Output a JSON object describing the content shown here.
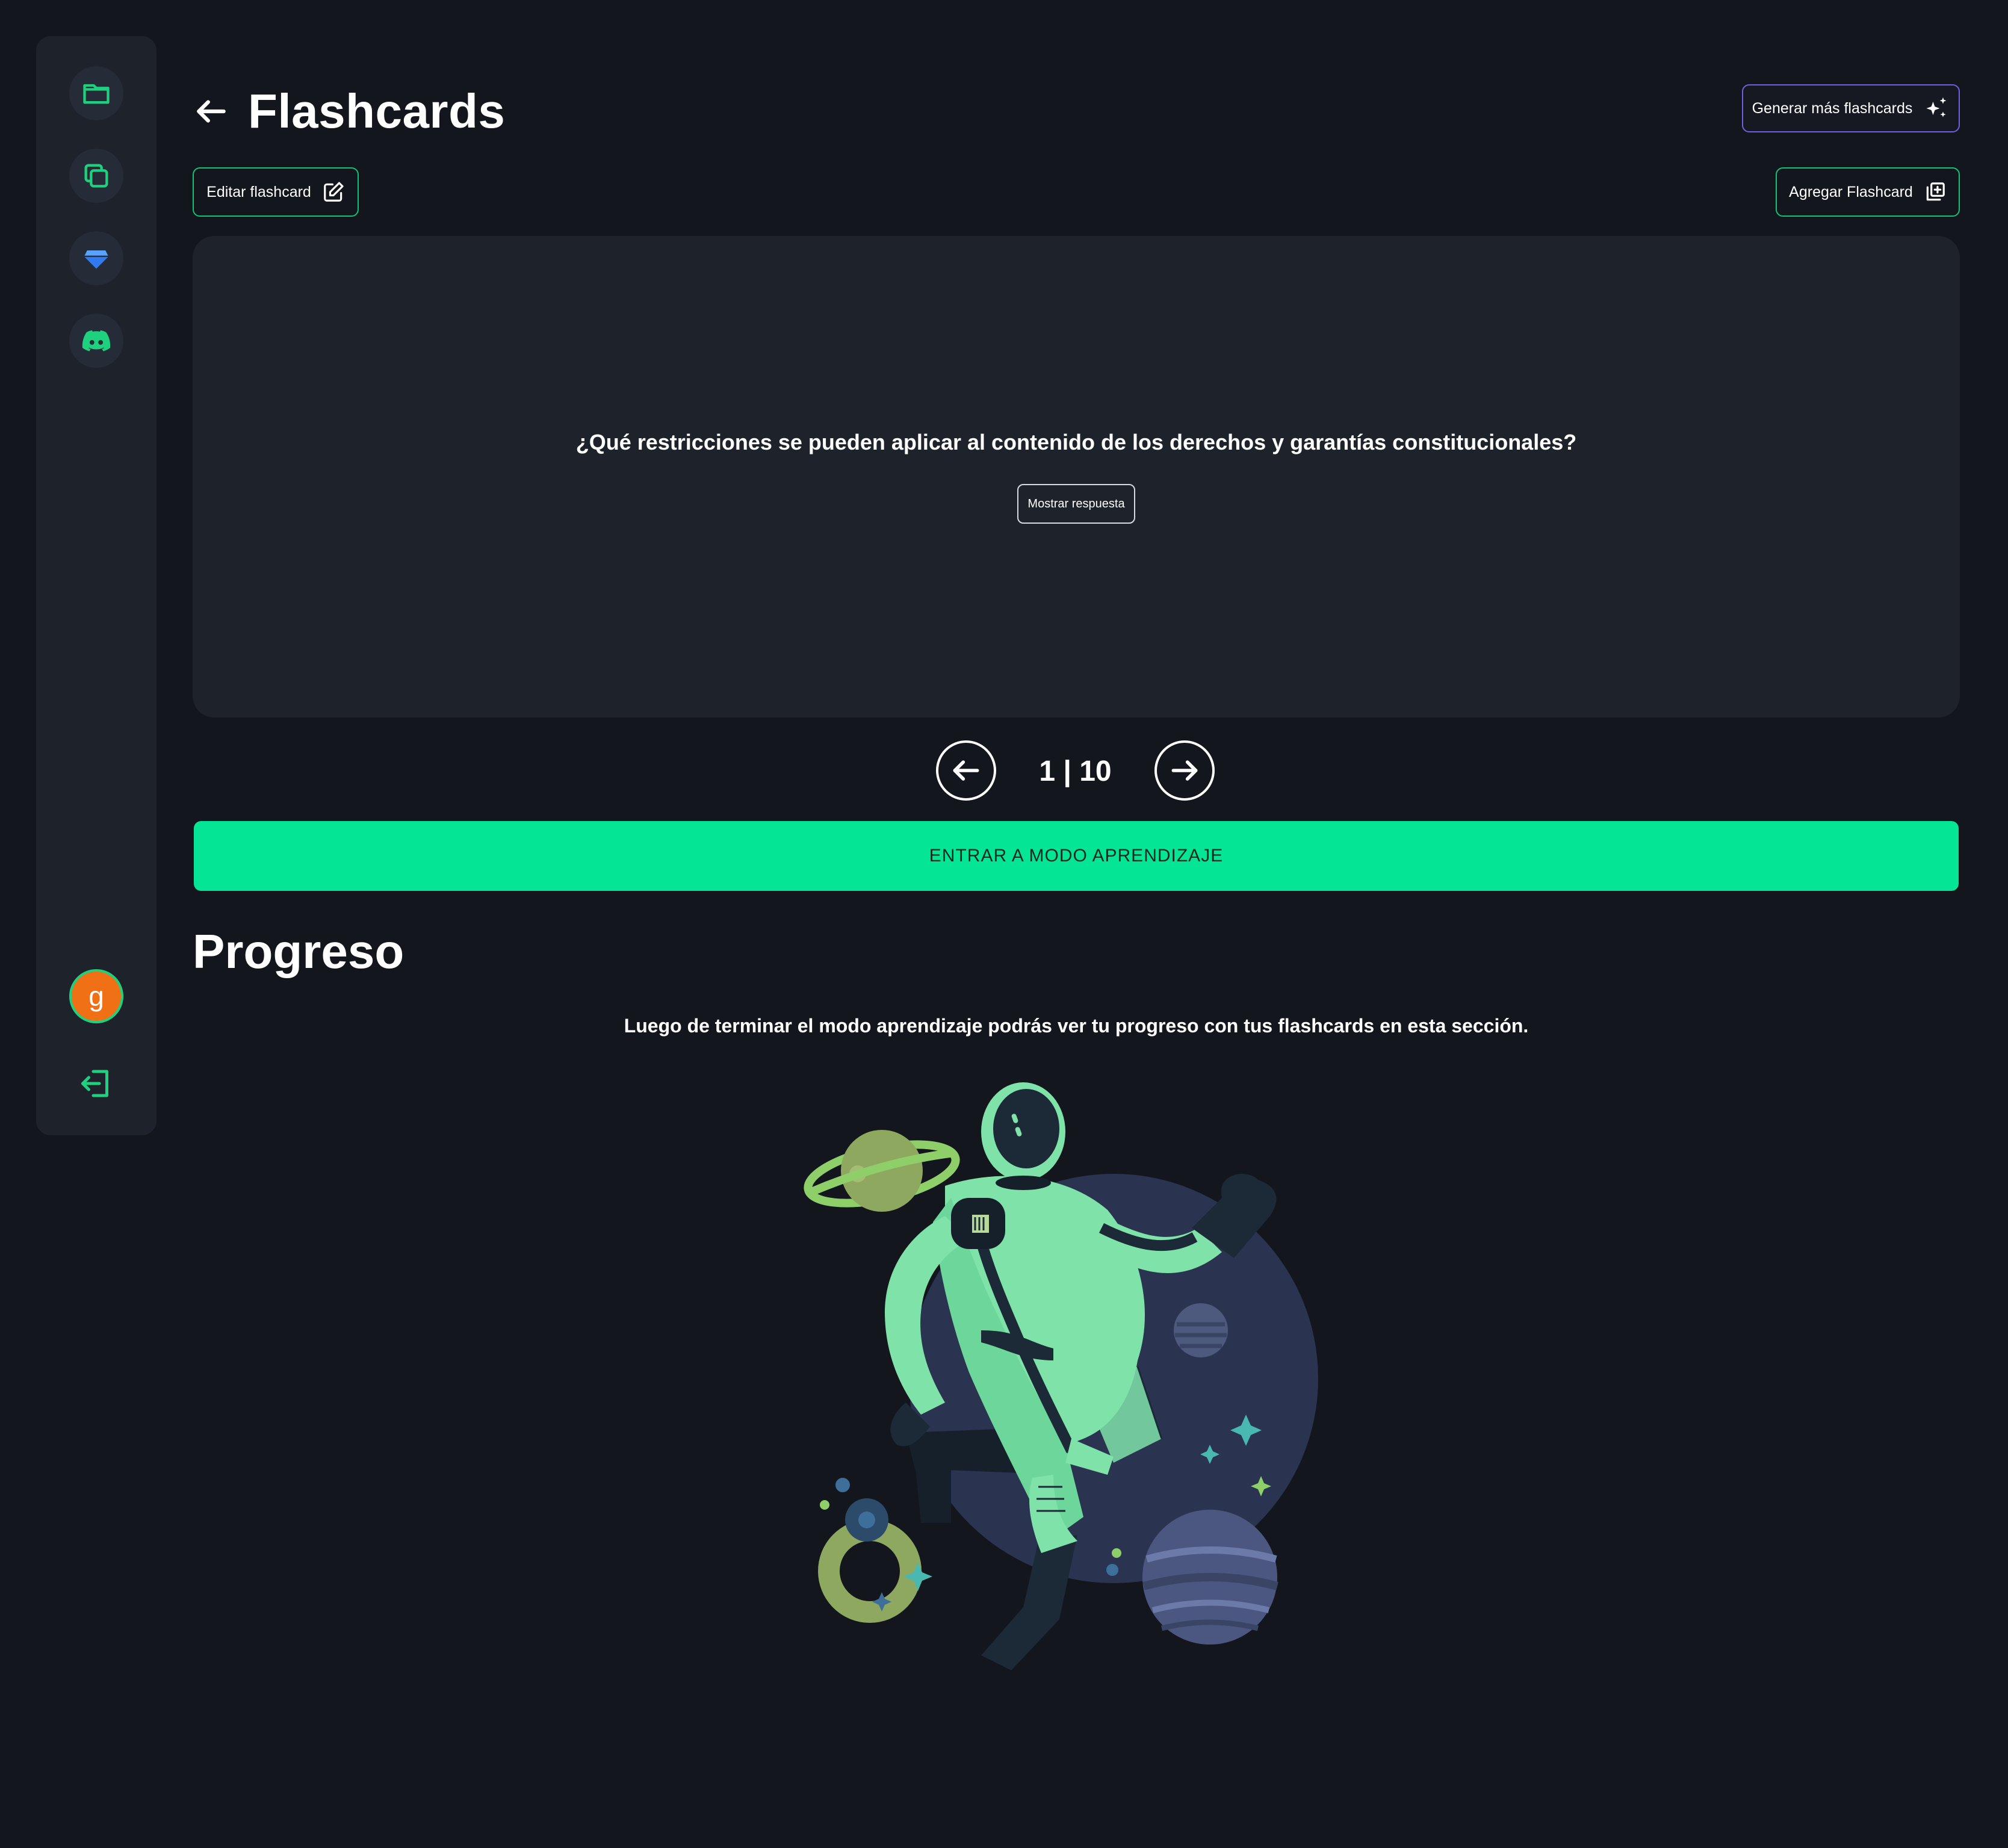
{
  "header": {
    "title": "Flashcards",
    "generate_label": "Generar más flashcards"
  },
  "toolbar": {
    "edit_label": "Editar flashcard",
    "add_label": "Agregar Flashcard"
  },
  "card": {
    "question": "¿Qué restricciones se pueden aplicar al contenido de los derechos y garantías constitucionales?",
    "show_answer_label": "Mostrar respuesta"
  },
  "pager": {
    "current": "1",
    "total": "10",
    "label": "1 | 10"
  },
  "learn_mode_label": "ENTRAR A MODO APRENDIZAJE",
  "progress": {
    "title": "Progreso",
    "description": "Luego de terminar el modo aprendizaje podrás ver tu progreso con tus flashcards en esta sección."
  },
  "sidebar": {
    "items": [
      {
        "icon": "folder-icon"
      },
      {
        "icon": "copy-icon"
      },
      {
        "icon": "diamond-icon"
      },
      {
        "icon": "discord-icon"
      }
    ],
    "avatar_initial": "g",
    "logout_icon": "logout-icon"
  },
  "colors": {
    "accent": "#04e695",
    "sidebar_icon": "#1fd07f",
    "generate_border": "#6d61e0",
    "avatar_bg": "#f07016",
    "diamond": "#2f7bef"
  }
}
